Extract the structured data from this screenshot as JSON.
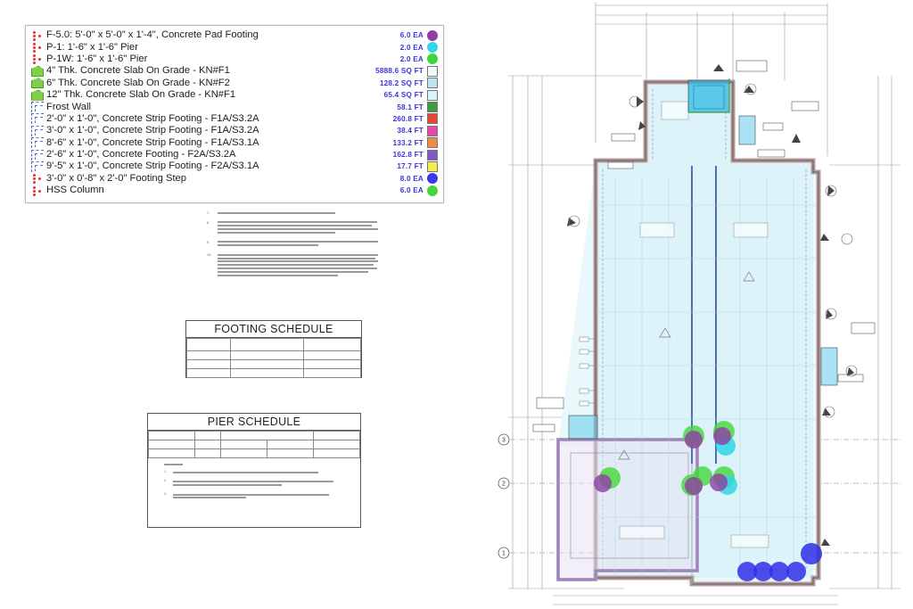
{
  "legend": {
    "items": [
      {
        "name": "F-5.0: 5'-0\" x 5'-0\" x 1'-4\", Concrete Pad Footing",
        "qty": "6.0 EA",
        "icon": "count-icon",
        "swatch": "#8e3fa3",
        "shape": "circle"
      },
      {
        "name": "P-1: 1'-6\" x 1'-6\" Pier",
        "qty": "2.0 EA",
        "icon": "count-icon",
        "swatch": "#2fd6e8",
        "shape": "circle"
      },
      {
        "name": "P-1W: 1'-6\" x 1'-6\" Pier",
        "qty": "2.0 EA",
        "icon": "count-icon",
        "swatch": "#3ad63a",
        "shape": "circle"
      },
      {
        "name": "4\" Thk. Concrete Slab On Grade - KN#F1",
        "qty": "5888.6 SQ FT",
        "icon": "area-icon",
        "swatch": "#eef9fb",
        "shape": "square"
      },
      {
        "name": "6\" Thk. Concrete Slab On Grade - KN#F2",
        "qty": "128.2 SQ FT",
        "icon": "area-icon",
        "swatch": "#bfe3f5",
        "shape": "square"
      },
      {
        "name": "12\" Thk. Concrete Slab On Grade - KN#F1",
        "qty": "65.4 SQ FT",
        "icon": "area-icon",
        "swatch": "#d9f2fb",
        "shape": "square"
      },
      {
        "name": "Frost Wall",
        "qty": "58.1 FT",
        "icon": "linear-icon",
        "swatch": "#3f9a3a",
        "shape": "square"
      },
      {
        "name": "2'-0\" x 1'-0\", Concrete Strip Footing - F1A/S3.2A",
        "qty": "260.8 FT",
        "icon": "linear-icon",
        "swatch": "#e6473b",
        "shape": "square"
      },
      {
        "name": "3'-0\" x 1'-0\", Concrete Strip Footing - F1A/S3.2A",
        "qty": "38.4 FT",
        "icon": "linear-icon",
        "swatch": "#e64aa6",
        "shape": "square"
      },
      {
        "name": "8'-6\" x 1'-0\", Concrete Strip Footing - F1A/S3.1A",
        "qty": "133.2 FT",
        "icon": "linear-icon",
        "swatch": "#f08a48",
        "shape": "square"
      },
      {
        "name": "2'-6\" x 1'-0\", Concrete Footing - F2A/S3.2A",
        "qty": "162.8 FT",
        "icon": "linear-icon",
        "swatch": "#8257c8",
        "shape": "square"
      },
      {
        "name": "9'-5\" x 1'-0\", Concrete Strip Footing - F2A/S3.1A",
        "qty": "17.7 FT",
        "icon": "linear-icon",
        "swatch": "#f2ee52",
        "shape": "square"
      },
      {
        "name": "3'-0\" x 0'-8\" x 2'-0\" Footing Step",
        "qty": "8.0 EA",
        "icon": "count-icon",
        "swatch": "#3a3ae8",
        "shape": "circle"
      },
      {
        "name": "HSS Column",
        "qty": "6.0 EA",
        "icon": "count-icon",
        "swatch": "#45d63c",
        "shape": "circle"
      }
    ]
  },
  "schedules": {
    "footing_title": "FOOTING SCHEDULE",
    "pier_title": "PIER SCHEDULE"
  },
  "plan": {
    "grid_labels": [
      "3",
      "2",
      "1"
    ]
  }
}
